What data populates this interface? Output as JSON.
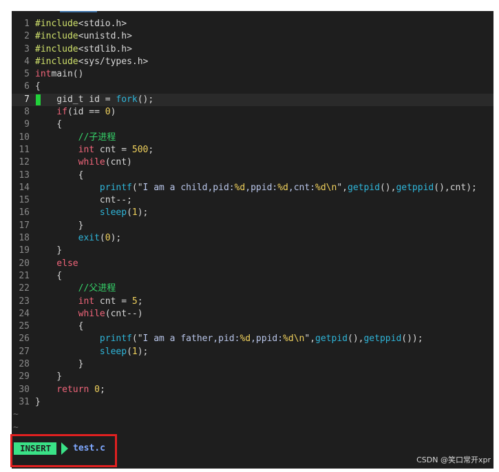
{
  "editor": {
    "cursor_line": 7,
    "lines": [
      {
        "n": "1",
        "tokens": [
          [
            "pp",
            "#include"
          ],
          [
            "inc",
            "<stdio.h>"
          ]
        ]
      },
      {
        "n": "2",
        "tokens": [
          [
            "pp",
            "#include"
          ],
          [
            "inc",
            "<unistd.h>"
          ]
        ]
      },
      {
        "n": "3",
        "tokens": [
          [
            "pp",
            "#include"
          ],
          [
            "inc",
            "<stdlib.h>"
          ]
        ]
      },
      {
        "n": "4",
        "tokens": [
          [
            "pp",
            "#include"
          ],
          [
            "inc",
            "<sys/types.h>"
          ]
        ]
      },
      {
        "n": "5",
        "tokens": [
          [
            "kw",
            "int"
          ],
          [
            "",
            "main"
          ],
          [
            "",
            "()"
          ]
        ]
      },
      {
        "n": "6",
        "tokens": [
          [
            "",
            "{"
          ]
        ]
      },
      {
        "n": "7",
        "tokens": [
          [
            "",
            "    gid_t id = "
          ],
          [
            "fn",
            "fork"
          ],
          [
            "",
            "();"
          ]
        ]
      },
      {
        "n": "8",
        "tokens": [
          [
            "kw",
            "    if"
          ],
          [
            "",
            "(id == "
          ],
          [
            "num",
            "0"
          ],
          [
            "",
            ")"
          ]
        ]
      },
      {
        "n": "9",
        "tokens": [
          [
            "",
            "    {"
          ]
        ]
      },
      {
        "n": "10",
        "tokens": [
          [
            "cm",
            "        //子进程"
          ]
        ]
      },
      {
        "n": "11",
        "tokens": [
          [
            "kw",
            "        int"
          ],
          [
            "",
            " cnt = "
          ],
          [
            "num",
            "500"
          ],
          [
            "",
            ";"
          ]
        ]
      },
      {
        "n": "12",
        "tokens": [
          [
            "kw",
            "        while"
          ],
          [
            "",
            "(cnt)"
          ]
        ]
      },
      {
        "n": "13",
        "tokens": [
          [
            "",
            "        {"
          ]
        ]
      },
      {
        "n": "14",
        "tokens": [
          [
            "fn",
            "            printf"
          ],
          [
            "",
            "(\""
          ],
          [
            "str",
            "I am a child,pid:"
          ],
          [
            "num",
            "%d"
          ],
          [
            "str",
            ",ppid:"
          ],
          [
            "num",
            "%d"
          ],
          [
            "str",
            ",cnt:"
          ],
          [
            "num",
            "%d\\n"
          ],
          [
            "",
            "\","
          ],
          [
            "fn",
            "getpid"
          ],
          [
            "",
            "(),"
          ],
          [
            "fn",
            "getppid"
          ],
          [
            "",
            "(),cnt);"
          ]
        ]
      },
      {
        "n": "15",
        "tokens": [
          [
            "",
            "            cnt--;"
          ]
        ]
      },
      {
        "n": "16",
        "tokens": [
          [
            "fn",
            "            sleep"
          ],
          [
            "",
            "("
          ],
          [
            "num",
            "1"
          ],
          [
            "",
            "); "
          ]
        ]
      },
      {
        "n": "17",
        "tokens": [
          [
            "",
            "        }"
          ]
        ]
      },
      {
        "n": "18",
        "tokens": [
          [
            "fn",
            "        exit"
          ],
          [
            "",
            "("
          ],
          [
            "num",
            "0"
          ],
          [
            "",
            "); "
          ]
        ]
      },
      {
        "n": "19",
        "tokens": [
          [
            "",
            "    }"
          ]
        ]
      },
      {
        "n": "20",
        "tokens": [
          [
            "kw",
            "    else"
          ]
        ]
      },
      {
        "n": "21",
        "tokens": [
          [
            "",
            "    {"
          ]
        ]
      },
      {
        "n": "22",
        "tokens": [
          [
            "cm",
            "        //父进程"
          ]
        ]
      },
      {
        "n": "23",
        "tokens": [
          [
            "kw",
            "        int"
          ],
          [
            "",
            " cnt = "
          ],
          [
            "num",
            "5"
          ],
          [
            "",
            ";"
          ]
        ]
      },
      {
        "n": "24",
        "tokens": [
          [
            "kw",
            "        while"
          ],
          [
            "",
            "(cnt--)"
          ]
        ]
      },
      {
        "n": "25",
        "tokens": [
          [
            "",
            "        {"
          ]
        ]
      },
      {
        "n": "26",
        "tokens": [
          [
            "fn",
            "            printf"
          ],
          [
            "",
            "(\""
          ],
          [
            "str",
            "I am a father,pid:"
          ],
          [
            "num",
            "%d"
          ],
          [
            "str",
            ",ppid:"
          ],
          [
            "num",
            "%d\\n"
          ],
          [
            "",
            "\","
          ],
          [
            "fn",
            "getpid"
          ],
          [
            "",
            "(),"
          ],
          [
            "fn",
            "getppid"
          ],
          [
            "",
            "());"
          ]
        ]
      },
      {
        "n": "27",
        "tokens": [
          [
            "fn",
            "            sleep"
          ],
          [
            "",
            "("
          ],
          [
            "num",
            "1"
          ],
          [
            "",
            "); "
          ]
        ]
      },
      {
        "n": "28",
        "tokens": [
          [
            "",
            "        }"
          ]
        ]
      },
      {
        "n": "29",
        "tokens": [
          [
            "",
            "    }"
          ]
        ]
      },
      {
        "n": "30",
        "tokens": [
          [
            "kw",
            "    return"
          ],
          [
            "",
            " "
          ],
          [
            "num",
            "0"
          ],
          [
            "",
            ";"
          ]
        ]
      },
      {
        "n": "31",
        "tokens": [
          [
            "",
            "}"
          ]
        ]
      }
    ],
    "empty_markers": [
      "~",
      "~"
    ]
  },
  "statusline": {
    "mode": "INSERT",
    "filename": "test.c"
  },
  "watermark": "CSDN @笑口常开xpr",
  "colors": {
    "background": "#1e1e1e",
    "keyword": "#f1657a",
    "function": "#2fb5d9",
    "number": "#f0d15d",
    "comment": "#36d36a",
    "mode_badge": "#3ae287",
    "filename": "#7fa8ff",
    "highlight_box": "#e02020"
  }
}
